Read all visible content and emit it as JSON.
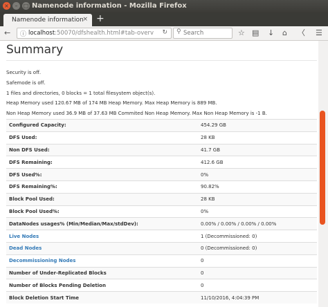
{
  "window": {
    "title": "Namenode information - Mozilla Firefox"
  },
  "tab": {
    "label": "Namenode information",
    "close": "×",
    "new_tab": "+"
  },
  "navbar": {
    "url_host": "localhost",
    "url_path": ":50070/dfshealth.html#tab-overv",
    "search_placeholder": "Search"
  },
  "page": {
    "heading": "Summary",
    "paragraphs": [
      "Security is off.",
      "Safemode is off.",
      "1 files and directories, 0 blocks = 1 total filesystem object(s).",
      "Heap Memory used 120.67 MB of 174 MB Heap Memory. Max Heap Memory is 889 MB.",
      "Non Heap Memory used 36.9 MB of 37.63 MB Commited Non Heap Memory. Max Non Heap Memory is -1 B."
    ],
    "rows": [
      {
        "key": "Configured Capacity:",
        "value": "454.29 GB"
      },
      {
        "key": "DFS Used:",
        "value": "28 KB"
      },
      {
        "key": "Non DFS Used:",
        "value": "41.7 GB"
      },
      {
        "key": "DFS Remaining:",
        "value": "412.6 GB"
      },
      {
        "key": "DFS Used%:",
        "value": "0%"
      },
      {
        "key": "DFS Remaining%:",
        "value": "90.82%"
      },
      {
        "key": "Block Pool Used:",
        "value": "28 KB"
      },
      {
        "key": "Block Pool Used%:",
        "value": "0%"
      },
      {
        "key": "DataNodes usages% (Min/Median/Max/stdDev):",
        "value": "0.00% / 0.00% / 0.00% / 0.00%"
      },
      {
        "key": "Live Nodes",
        "value": "1 (Decommissioned: 0)",
        "link": true
      },
      {
        "key": "Dead Nodes",
        "value": "0 (Decommissioned: 0)",
        "link": true
      },
      {
        "key": "Decommissioning Nodes",
        "value": "0",
        "link": true
      },
      {
        "key": "Number of Under-Replicated Blocks",
        "value": "0"
      },
      {
        "key": "Number of Blocks Pending Deletion",
        "value": "0"
      },
      {
        "key": "Block Deletion Start Time",
        "value": "11/10/2016, 4:04:39 PM"
      }
    ]
  },
  "colors": {
    "accent_scrollbar": "#e95420",
    "link": "#337ab7",
    "titlebar": "#3c3b37"
  }
}
